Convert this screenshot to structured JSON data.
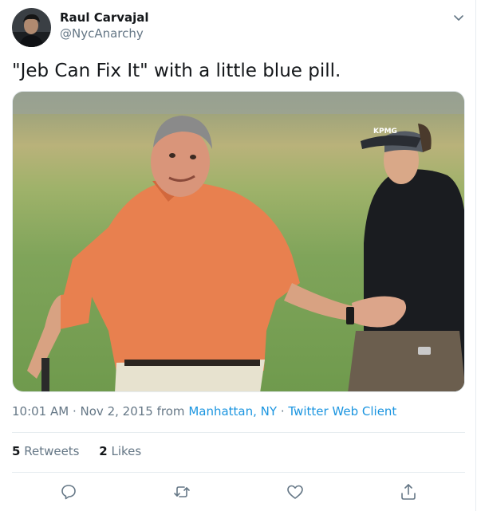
{
  "user": {
    "name": "Raul Carvajal",
    "handle": "@NycAnarchy"
  },
  "tweet": {
    "text": "\"Jeb Can Fix It\" with a little blue pill."
  },
  "meta": {
    "time": "10:01 AM",
    "date": "Nov 2, 2015",
    "from_label": "from",
    "location": "Manhattan, NY",
    "client": "Twitter Web Client"
  },
  "stats": {
    "retweets_count": "5",
    "retweets_label": "Retweets",
    "likes_count": "2",
    "likes_label": "Likes"
  },
  "media": {
    "cap_logo_text": "KPMG"
  },
  "icons": {
    "caret": "chevron-down-icon",
    "reply": "reply-icon",
    "retweet": "retweet-icon",
    "like": "heart-icon",
    "share": "share-icon"
  },
  "colors": {
    "link": "#1b95e0",
    "secondary": "#657786",
    "text": "#14171a",
    "divider": "#e6ecf0"
  }
}
